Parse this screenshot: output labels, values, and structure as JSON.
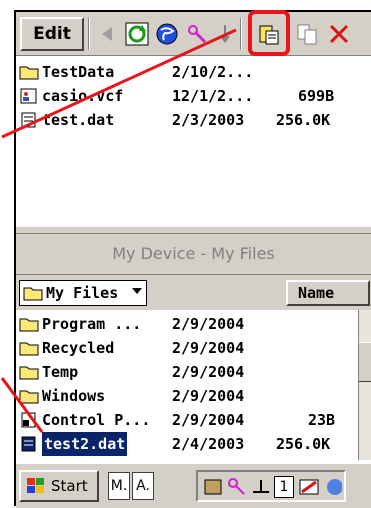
{
  "toolbar": {
    "edit_label": "Edit",
    "icons": [
      "back-arrow-icon",
      "refresh-icon",
      "globe-icon",
      "highlighter-icon",
      "down-arrow-icon",
      "paste-icon",
      "copy-icon",
      "delete-icon"
    ],
    "highlight_color": "#e8141c"
  },
  "upper_files": [
    {
      "name": "TestData",
      "date": "2/10/2...",
      "size": "",
      "type": "folder"
    },
    {
      "name": "casio.vcf",
      "date": "12/1/2...",
      "size": "699B",
      "type": "contact"
    },
    {
      "name": "test.dat",
      "date": "2/3/2003",
      "size": "256.0K",
      "type": "file"
    }
  ],
  "title": "My Device - My Files",
  "location": {
    "selected": "My Files"
  },
  "sort": {
    "label": "Name"
  },
  "lower_files": [
    {
      "name": "Program ...",
      "date": "2/9/2004",
      "size": "",
      "type": "folder"
    },
    {
      "name": "Recycled",
      "date": "2/9/2004",
      "size": "",
      "type": "folder"
    },
    {
      "name": "Temp",
      "date": "2/9/2004",
      "size": "",
      "type": "folder"
    },
    {
      "name": "Windows",
      "date": "2/9/2004",
      "size": "",
      "type": "folder"
    },
    {
      "name": "Control P...",
      "date": "2/9/2004",
      "size": "23B",
      "type": "file"
    },
    {
      "name": "test2.dat",
      "date": "2/4/2003",
      "size": "256.0K",
      "type": "file",
      "selected": true
    }
  ],
  "taskbar": {
    "start_label": "Start",
    "tasks": [
      "M.",
      "A."
    ],
    "tray_number": "1"
  },
  "colors": {
    "selection": "#0a246a",
    "chrome": "#d4d0c8",
    "annotation": "#e8141c"
  }
}
